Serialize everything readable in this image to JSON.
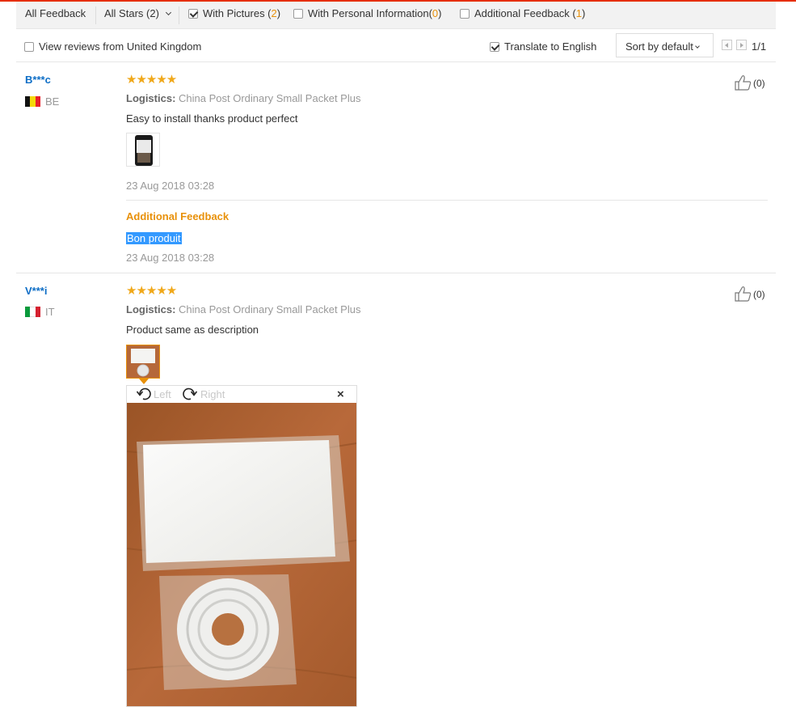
{
  "filters": {
    "all_feedback": "All Feedback",
    "all_stars": "All Stars (2)",
    "with_pictures_label": "With Pictures (",
    "with_pictures_count": "2",
    "with_personal_label": "With Personal Information(",
    "with_personal_count": "0",
    "additional_label": "Additional Feedback (",
    "additional_count": "1",
    "close_paren": ")"
  },
  "options": {
    "uk_reviews": "View reviews from United Kingdom",
    "translate": "Translate to English",
    "sort": "Sort by default",
    "page": "1/1"
  },
  "reviews": [
    {
      "user": "B***c",
      "country": "BE",
      "stars": "★★★★★",
      "logistics_label": "Logistics:",
      "logistics": "China Post Ordinary Small Packet Plus",
      "text": "Easy to install thanks product perfect",
      "date": "23 Aug 2018 03:28",
      "helpful": "(0)",
      "additional_title": "Additional Feedback",
      "additional_text": "Bon produit",
      "additional_date": "23 Aug 2018 03:28"
    },
    {
      "user": "V***i",
      "country": "IT",
      "stars": "★★★★★",
      "logistics_label": "Logistics:",
      "logistics": "China Post Ordinary Small Packet Plus",
      "text": "Product same as description",
      "helpful": "(0)"
    }
  ],
  "viewer": {
    "rotate_left": "Left",
    "rotate_right": "Right",
    "close": "×"
  },
  "colors": {
    "accent_orange": "#e8910b",
    "username_blue": "#0e6ec6",
    "selection_blue": "#3399ff",
    "top_rule_red": "#e62e04"
  }
}
